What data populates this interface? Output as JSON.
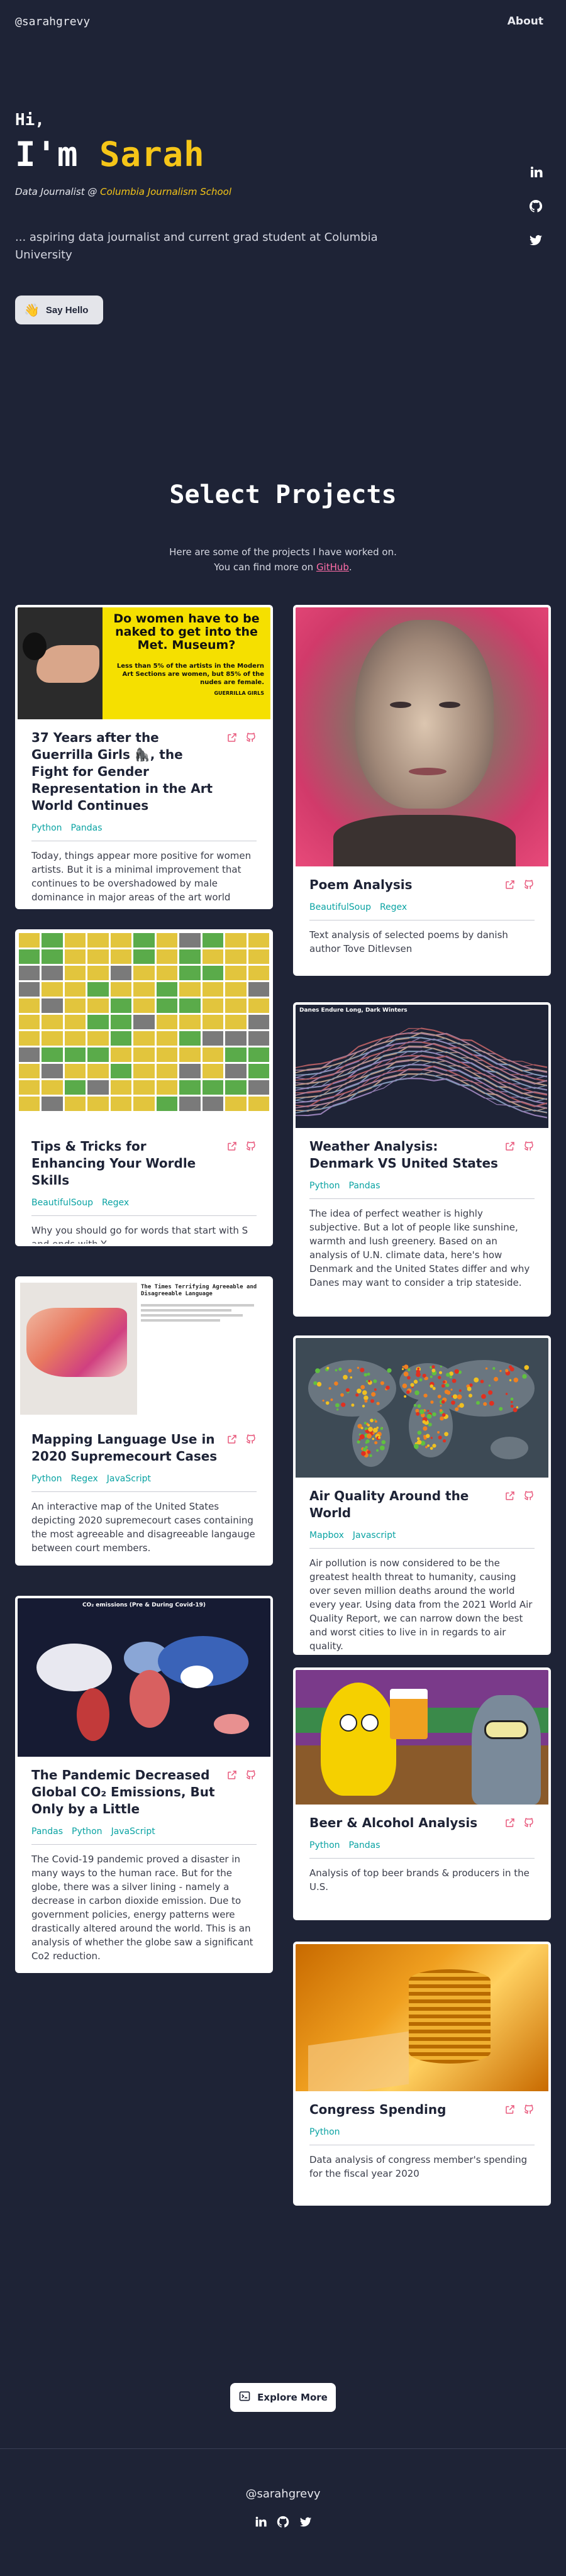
{
  "nav": {
    "brand": "@sarahgrevy",
    "about": "About"
  },
  "hero": {
    "hi": "Hi,",
    "name_prefix": "I'm ",
    "name": "Sarah",
    "role_prefix": "Data Journalist @ ",
    "school": "Columbia Journalism School",
    "desc": "... aspiring data journalist and current grad student at Columbia University",
    "say_hello": "Say Hello"
  },
  "section": {
    "title": "Select Projects",
    "sub1": "Here are some of the projects I have worked on.",
    "sub2_prefix": "You can find more on ",
    "sub2_link": "GitHub",
    "sub2_suffix": "."
  },
  "projects": [
    {
      "title": "37 Years after the Guerrilla Girls 🦍, the Fight for Gender Representation in the Art World Continues",
      "tags": [
        "Python",
        "Pandas"
      ],
      "desc": "Today, things appear more positive for women artists. But it is a minimal improvement that continues to be overshadowed by male dominance in major areas of the art world",
      "thumb": "Do women have to be naked to get into the Met. Museum?",
      "thumb_sub": "Less than 5% of the artists in the Modern Art Sections are women, but 85% of the nudes are female.",
      "thumb_credit": "GUERRILLA GIRLS"
    },
    {
      "title": "Poem Analysis",
      "tags": [
        "BeautifulSoup",
        "Regex"
      ],
      "desc": "Text analysis of selected poems by danish author Tove Ditlevsen"
    },
    {
      "title": "Tips & Tricks for Enhancing Your Wordle Skills",
      "tags": [
        "BeautifulSoup",
        "Regex"
      ],
      "desc": "Why you should go for words that start with S and ends with Y"
    },
    {
      "title": "Weather Analysis: Denmark VS United States",
      "tags": [
        "Python",
        "Pandas"
      ],
      "desc": "The idea of perfect weather is highly subjective. But a lot of people like sunshine, warmth and lush greenery. Based on an analysis of U.N. climate data, here's how Denmark and the United States differ and why Danes may want to consider a trip stateside.",
      "thumb": "Danes Endure Long, Dark Winters"
    },
    {
      "title": "Mapping Language Use in 2020 Supremecourt Cases",
      "tags": [
        "Python",
        "Regex",
        "JavaScript"
      ],
      "desc": "An interactive map of the United States depicting 2020 supremecourt cases containing the most agreeable and disagreeable langauge between court members.",
      "thumb": "The Times Terrifying Agreeable and Disagreeable Language"
    },
    {
      "title": "Air Quality Around the World",
      "tags": [
        "Mapbox",
        "Javascript"
      ],
      "desc": "Air pollution is now considered to be the greatest health threat to humanity, causing over seven million deaths around the world every year. Using data from the 2021 World Air Quality Report, we can narrow down the best and worst cities to live in in regards to air quality."
    },
    {
      "title": "The Pandemic Decreased Global CO₂ Emissions, But Only by a Little",
      "tags": [
        "Pandas",
        "Python",
        "JavaScript"
      ],
      "desc": "The Covid-19 pandemic proved a disaster in many ways to the human race. But for the globe, there was a silver lining - namely a decrease in carbon dioxide emission. Due to government policies, energy patterns were drastically altered around the world. This is an analysis of whether the globe saw a significant Co2 reduction.",
      "thumb": "CO₂ emissions (Pre & During Covid-19)"
    },
    {
      "title": "Beer & Alcohol Analysis",
      "tags": [
        "Python",
        "Pandas"
      ],
      "desc": "Analysis of top beer brands & producers in the U.S."
    },
    {
      "title": "Congress Spending",
      "tags": [
        "Python"
      ],
      "desc": "Data analysis of congress member's spending for the fiscal year 2020"
    }
  ],
  "explore": "Explore More",
  "footer": {
    "brand": "@sarahgrevy"
  },
  "colors": {
    "bg": "#1e2336",
    "accent": "#f5c518",
    "link": "#ff6ea8",
    "tag": "#0aa3a3"
  }
}
